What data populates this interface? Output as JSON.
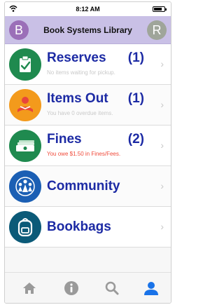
{
  "status_bar": {
    "time": "8:12 AM",
    "battery_level": 0.8
  },
  "header": {
    "title": "Book Systems Library",
    "left_avatar_letter": "B",
    "right_avatar_letter": "R"
  },
  "menu": {
    "items": [
      {
        "label": "Reserves",
        "count": "(1)",
        "subtitle": "No items waiting for pickup.",
        "icon": "clipboard-check-icon",
        "icon_color": "#1f8a4f",
        "subtitle_color": "#c9c9c9"
      },
      {
        "label": "Items Out",
        "count": "(1)",
        "subtitle": "You have 0 overdue items.",
        "icon": "book-reader-icon",
        "icon_color": "#f39a1c",
        "subtitle_color": "#c9c9c9"
      },
      {
        "label": "Fines",
        "count": "(2)",
        "subtitle": "You owe $1.50 in Fines/Fees.",
        "icon": "money-icon",
        "icon_color": "#1f8a4f",
        "subtitle_color": "#f04a3a"
      },
      {
        "label": "Community",
        "count": "",
        "subtitle": "",
        "icon": "community-icon",
        "icon_color": "#1b5fb4",
        "subtitle_color": "#c9c9c9"
      },
      {
        "label": "Bookbags",
        "count": "",
        "subtitle": "",
        "icon": "backpack-icon",
        "icon_color": "#0b5a78",
        "subtitle_color": "#c9c9c9"
      }
    ]
  },
  "tab_bar": {
    "tabs": [
      {
        "icon": "home-icon",
        "active": false
      },
      {
        "icon": "info-icon",
        "active": false
      },
      {
        "icon": "search-icon",
        "active": false
      },
      {
        "icon": "user-icon",
        "active": true
      }
    ],
    "active_color": "#1a73e8",
    "inactive_color": "#9a9a9a"
  }
}
